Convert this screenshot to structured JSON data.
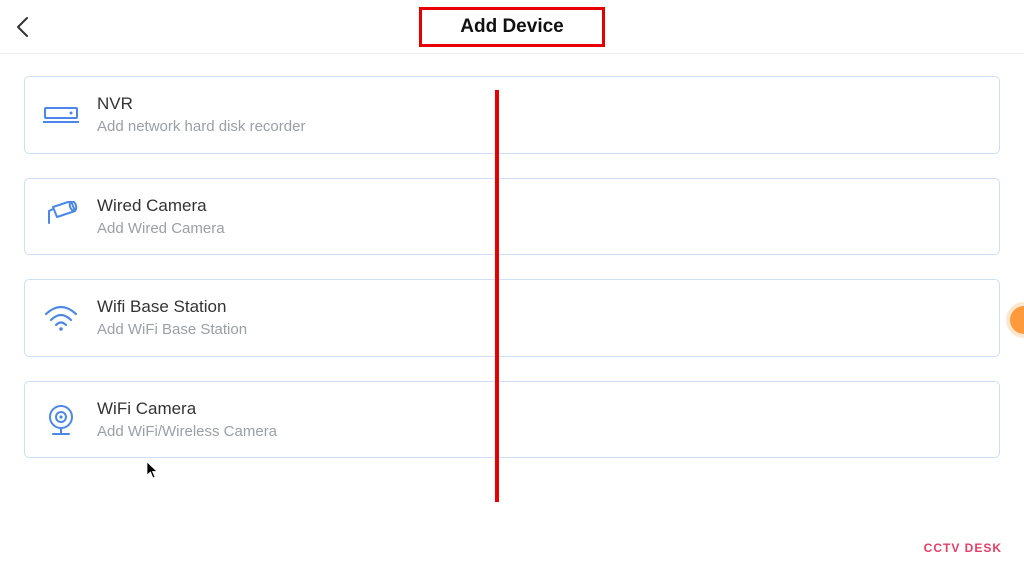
{
  "header": {
    "title": "Add Device"
  },
  "devices": [
    {
      "id": "nvr",
      "title": "NVR",
      "subtitle": "Add network hard disk recorder"
    },
    {
      "id": "wired-camera",
      "title": "Wired Camera",
      "subtitle": "Add Wired Camera"
    },
    {
      "id": "wifi-base-station",
      "title": "Wifi Base Station",
      "subtitle": "Add WiFi Base Station"
    },
    {
      "id": "wifi-camera",
      "title": "WiFi Camera",
      "subtitle": "Add WiFi/Wireless Camera"
    }
  ],
  "watermark": "CCTV DESK",
  "colors": {
    "accent": "#4a87e8",
    "annotation": "#e60000",
    "card_border": "#cde0f5",
    "subtitle": "#9aa0a6"
  }
}
